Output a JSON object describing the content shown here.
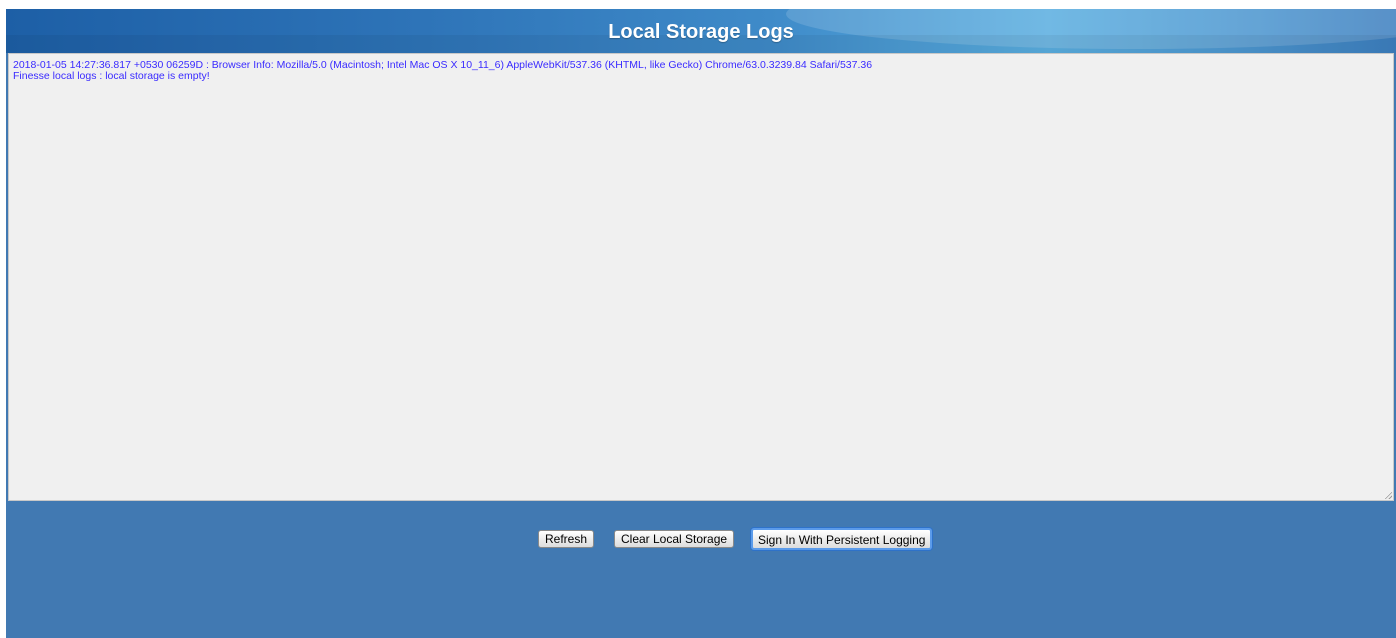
{
  "header": {
    "title": "Local Storage Logs"
  },
  "log": {
    "lines": [
      "2018-01-05 14:27:36.817 +0530 06259D : Browser Info: Mozilla/5.0 (Macintosh; Intel Mac OS X 10_11_6) AppleWebKit/537.36 (KHTML, like Gecko) Chrome/63.0.3239.84 Safari/537.36",
      "Finesse local logs : local storage is empty!"
    ]
  },
  "buttons": {
    "refresh": "Refresh",
    "clear": "Clear Local Storage",
    "signin": "Sign In With Persistent Logging"
  },
  "colors": {
    "background": "#4179b2",
    "log_text": "#3a2bff",
    "log_background": "#f0f0f0"
  }
}
